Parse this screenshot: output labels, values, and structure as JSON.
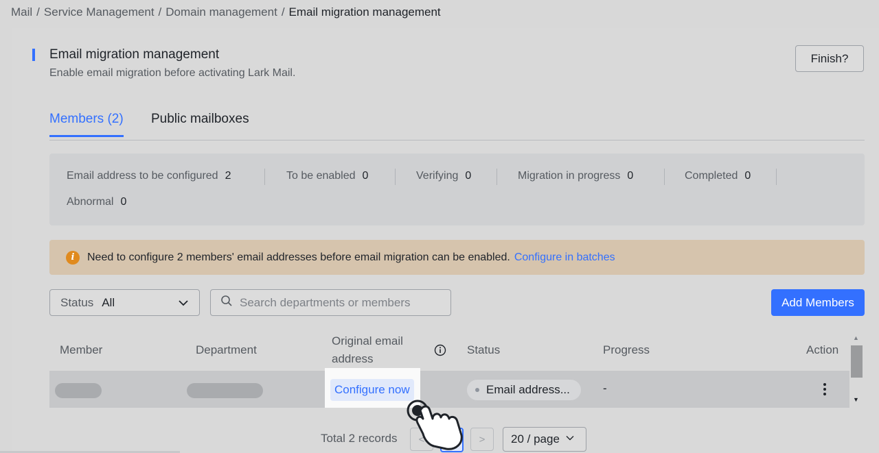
{
  "breadcrumb": [
    "Mail",
    "Service Management",
    "Domain management",
    "Email migration management"
  ],
  "header": {
    "title": "Email migration management",
    "subtitle": "Enable email migration before activating Lark Mail.",
    "finish_label": "Finish?"
  },
  "tabs": [
    {
      "label": "Members (2)",
      "active": true
    },
    {
      "label": "Public mailboxes",
      "active": false
    }
  ],
  "stats": [
    {
      "label": "Email address to be configured",
      "value": "2"
    },
    {
      "label": "To be enabled",
      "value": "0"
    },
    {
      "label": "Verifying",
      "value": "0"
    },
    {
      "label": "Migration in progress",
      "value": "0"
    },
    {
      "label": "Completed",
      "value": "0"
    },
    {
      "label": "Abnormal",
      "value": "0"
    }
  ],
  "alert": {
    "icon": "info-icon",
    "text": "Need to configure 2 members' email addresses before email migration can be enabled.",
    "link": "Configure in batches",
    "color": "#d6c4ad"
  },
  "filters": {
    "status_label": "Status",
    "status_value": "All",
    "search_placeholder": "Search departments or members",
    "add_button": "Add Members"
  },
  "table": {
    "columns": [
      "Member",
      "Department",
      "Original email address",
      "Status",
      "Progress",
      "Action"
    ],
    "column_line1": "Original email",
    "column_line2": "address",
    "rows": [
      {
        "configure": "Configure now",
        "status": "Email address...",
        "progress": "-"
      }
    ]
  },
  "pagination": {
    "total": "Total 2 records",
    "prev": "<",
    "next": ">",
    "page_size": "20 / page"
  },
  "colors": {
    "accent": "#3370ff",
    "warning": "#e08a1e"
  }
}
